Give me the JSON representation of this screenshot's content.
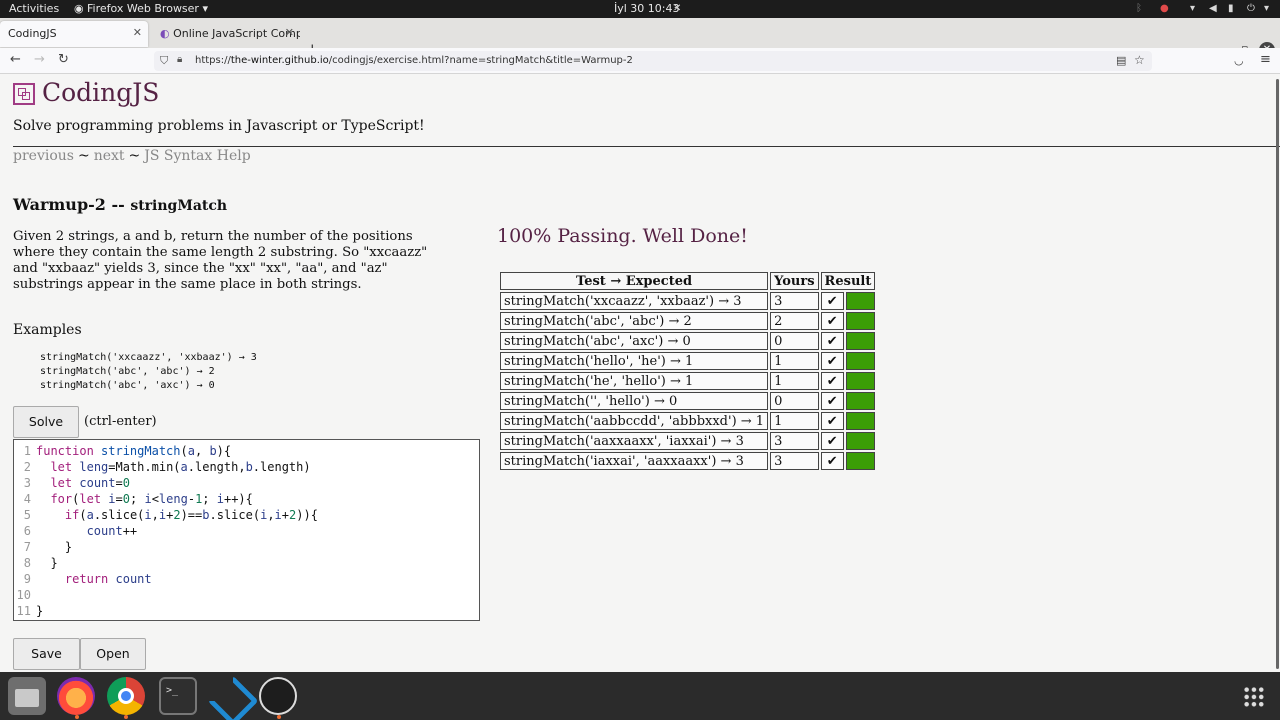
{
  "topbar": {
    "activities": "Activities",
    "app_menu": "Firefox Web Browser ▾",
    "clock": "İyl 30  10:43"
  },
  "browser": {
    "tabs": [
      {
        "label": "CodingJS",
        "active": true
      },
      {
        "label": "Online JavaScript Compil",
        "active": false
      }
    ],
    "url_prefix": "https://",
    "url_domain": "the-winter.github.io",
    "url_path": "/codingjs/exercise.html?name=stringMatch&title=Warmup-2"
  },
  "site": {
    "title": "CodingJS",
    "subtitle": "Solve programming problems in Javascript or TypeScript!",
    "nav": {
      "previous": "previous",
      "next": "next",
      "help": "JS Syntax Help",
      "sep": "~"
    }
  },
  "problem": {
    "group": "Warmup-2 --",
    "name": "stringMatch",
    "description": "Given 2 strings, a and b, return the number of the positions where they contain the same length 2 substring. So \"xxcaazz\" and \"xxbaaz\" yields 3, since the \"xx\" \"xx\", \"aa\", and \"az\" substrings appear in the same place in both strings.",
    "examples_title": "Examples",
    "examples": [
      "stringMatch('xxcaazz', 'xxbaaz') → 3",
      "stringMatch('abc', 'abc') → 2",
      "stringMatch('abc', 'axc') → 0"
    ]
  },
  "controls": {
    "solve": "Solve",
    "solve_hint": "(ctrl-enter)",
    "save": "Save",
    "open": "Open"
  },
  "editor": {
    "line_numbers": [
      "1",
      "2",
      "3",
      "4",
      "5",
      "6",
      "7",
      "8",
      "9",
      "10",
      "11"
    ]
  },
  "results": {
    "headline": "100% Passing. Well Done!",
    "headers": {
      "test": "Test → Expected",
      "yours": "Yours",
      "result": "Result"
    },
    "check": "✔",
    "pass_color": "#3b9e06",
    "rows": [
      {
        "test": "stringMatch('xxcaazz', 'xxbaaz') → 3",
        "yours": "3"
      },
      {
        "test": "stringMatch('abc', 'abc') → 2",
        "yours": "2"
      },
      {
        "test": "stringMatch('abc', 'axc') → 0",
        "yours": "0"
      },
      {
        "test": "stringMatch('hello', 'he') → 1",
        "yours": "1"
      },
      {
        "test": "stringMatch('he', 'hello') → 1",
        "yours": "1"
      },
      {
        "test": "stringMatch('', 'hello') → 0",
        "yours": "0"
      },
      {
        "test": "stringMatch('aabbccdd', 'abbbxxd') → 1",
        "yours": "1"
      },
      {
        "test": "stringMatch('aaxxaaxx', 'iaxxai') → 3",
        "yours": "3"
      },
      {
        "test": "stringMatch('iaxxai', 'aaxxaaxx') → 3",
        "yours": "3"
      }
    ]
  },
  "dock": {
    "terminal_glyph": ">_"
  }
}
